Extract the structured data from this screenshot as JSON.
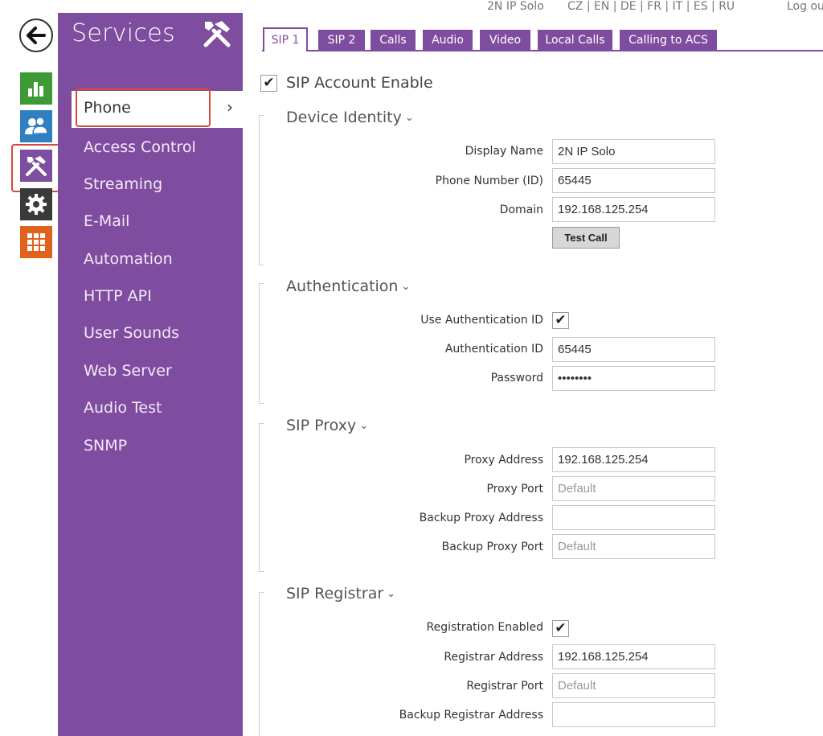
{
  "top": {
    "device_name": "2N IP Solo",
    "languages": "CZ | EN | DE | FR | IT | ES | RU",
    "logout": "Log out"
  },
  "rail": {
    "items": [
      {
        "icon": "back-arrow-icon"
      },
      {
        "icon": "status-chart-icon",
        "color": "#3e9a35"
      },
      {
        "icon": "users-icon",
        "color": "#2f7fc1"
      },
      {
        "icon": "tools-icon",
        "color": "#7e4ea0"
      },
      {
        "icon": "gear-icon",
        "color": "#3a3a3a"
      },
      {
        "icon": "grid-icon",
        "color": "#e0621d"
      }
    ]
  },
  "menu": {
    "title": "Services",
    "active_item": "Phone",
    "active_chevron": "›",
    "items": [
      "Access Control",
      "Streaming",
      "E-Mail",
      "Automation",
      "HTTP API",
      "User Sounds",
      "Web Server",
      "Audio Test",
      "SNMP"
    ]
  },
  "tabs": {
    "active": "SIP 1",
    "others": [
      "SIP 2",
      "Calls",
      "Audio",
      "Video",
      "Local Calls",
      "Calling to ACS"
    ]
  },
  "sip_account_enable": {
    "label": "SIP Account Enable",
    "checked": true
  },
  "device_identity": {
    "title": "Device Identity",
    "display_name": {
      "label": "Display Name",
      "value": "2N IP Solo"
    },
    "phone_number": {
      "label": "Phone Number (ID)",
      "value": "65445"
    },
    "domain": {
      "label": "Domain",
      "value": "192.168.125.254"
    },
    "test_call": "Test Call"
  },
  "authentication": {
    "title": "Authentication",
    "use_auth_id": {
      "label": "Use Authentication ID",
      "checked": true
    },
    "auth_id": {
      "label": "Authentication ID",
      "value": "65445"
    },
    "password": {
      "label": "Password",
      "value": "••••••••"
    }
  },
  "sip_proxy": {
    "title": "SIP Proxy",
    "proxy_address": {
      "label": "Proxy Address",
      "value": "192.168.125.254"
    },
    "proxy_port": {
      "label": "Proxy Port",
      "placeholder": "Default"
    },
    "backup_proxy_address": {
      "label": "Backup Proxy Address",
      "value": ""
    },
    "backup_proxy_port": {
      "label": "Backup Proxy Port",
      "placeholder": "Default"
    }
  },
  "sip_registrar": {
    "title": "SIP Registrar",
    "registration_enabled": {
      "label": "Registration Enabled",
      "checked": true
    },
    "registrar_address": {
      "label": "Registrar Address",
      "value": "192.168.125.254"
    },
    "registrar_port": {
      "label": "Registrar Port",
      "placeholder": "Default"
    },
    "backup_registrar_address": {
      "label": "Backup Registrar Address",
      "value": ""
    }
  },
  "check_glyph": "✔",
  "section_caret": "⌄",
  "colors": {
    "accent": "#7f4d9f",
    "highlight": "#d24b3c"
  }
}
